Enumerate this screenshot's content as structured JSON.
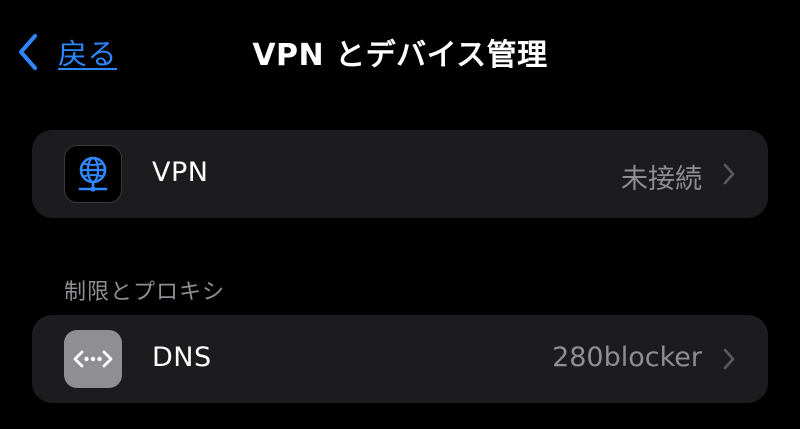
{
  "nav": {
    "back_label": "戻る",
    "back_icon": "chevron-left-icon",
    "title": "VPN とデバイス管理"
  },
  "rows": [
    {
      "icon": "vpn-globe-icon",
      "label": "VPN",
      "value": "未接続",
      "accessory_icon": "chevron-right-icon"
    }
  ],
  "sections": [
    {
      "header": "制限とプロキシ",
      "rows": [
        {
          "icon": "dns-icon",
          "label": "DNS",
          "value": "280blocker",
          "accessory_icon": "chevron-right-icon"
        }
      ]
    }
  ],
  "colors": {
    "background": "#000000",
    "cell_background": "#1c1c1e",
    "accent": "#2f87ff",
    "secondary_text": "#8e8e93",
    "dns_icon_background": "#8e8e93"
  }
}
